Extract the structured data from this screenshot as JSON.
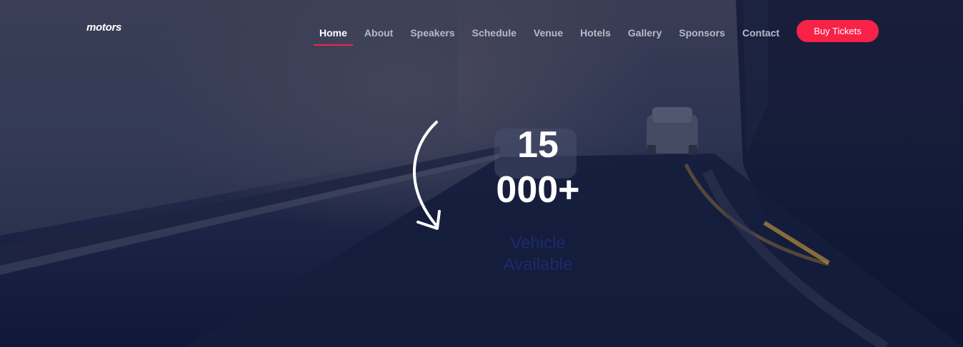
{
  "header": {
    "logo": "motors",
    "nav": [
      {
        "label": "Home",
        "active": true
      },
      {
        "label": "About",
        "active": false
      },
      {
        "label": "Speakers",
        "active": false
      },
      {
        "label": "Schedule",
        "active": false
      },
      {
        "label": "Venue",
        "active": false
      },
      {
        "label": "Hotels",
        "active": false
      },
      {
        "label": "Gallery",
        "active": false
      },
      {
        "label": "Sponsors",
        "active": false
      },
      {
        "label": "Contact",
        "active": false
      }
    ],
    "cta_label": "Buy Tickets"
  },
  "hero": {
    "stat_value_line1": "15",
    "stat_value_line2": "000+",
    "stat_label_line1": "Vehicle",
    "stat_label_line2": "Available",
    "arrow_icon": "curved-arrow-down-icon"
  },
  "colors": {
    "accent": "#f82249",
    "nav_text": "#b7bac8",
    "stat_label": "#1c2b6b"
  }
}
